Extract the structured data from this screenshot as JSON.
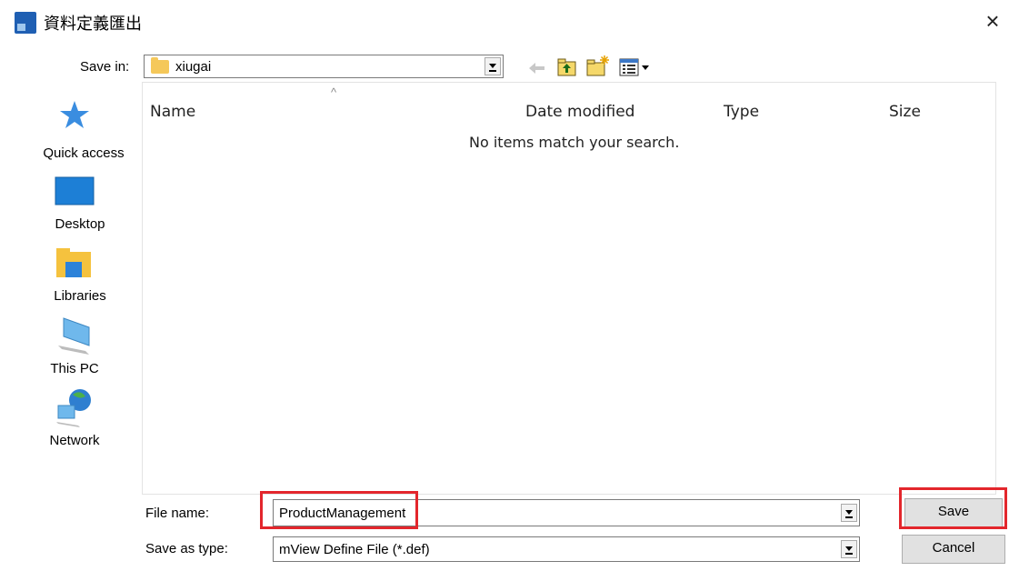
{
  "window": {
    "title": "資料定義匯出",
    "close_glyph": "×"
  },
  "save_in": {
    "label": "Save in:",
    "folder": "xiugai"
  },
  "toolbar": {
    "icons": [
      "back-arrow-icon",
      "up-folder-icon",
      "new-folder-icon",
      "view-menu-icon"
    ]
  },
  "places": [
    {
      "label": "Quick access",
      "icon": "star-icon"
    },
    {
      "label": "Desktop",
      "icon": "desktop-icon"
    },
    {
      "label": "Libraries",
      "icon": "libraries-icon"
    },
    {
      "label": "This PC",
      "icon": "computer-icon"
    },
    {
      "label": "Network",
      "icon": "network-icon"
    }
  ],
  "file_list": {
    "columns": [
      "Name",
      "Date modified",
      "Type",
      "Size"
    ],
    "sort_glyph": "^",
    "empty_message": "No items match your search."
  },
  "file_name": {
    "label": "File name:",
    "value": "ProductManagement"
  },
  "save_as_type": {
    "label": "Save as type:",
    "value": "mView Define File (*.def)"
  },
  "buttons": {
    "save": "Save",
    "cancel": "Cancel"
  },
  "colors": {
    "highlight": "#e3262c",
    "brand": "#1f5fb3"
  }
}
